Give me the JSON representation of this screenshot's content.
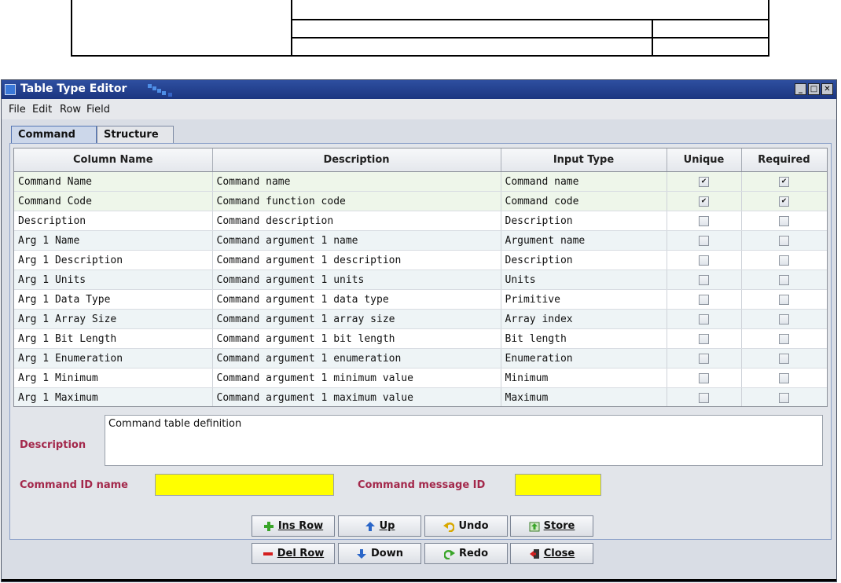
{
  "window": {
    "title": "Table Type Editor"
  },
  "menu": [
    "File",
    "Edit",
    "Row",
    "Field"
  ],
  "tabs": [
    {
      "label": "Command",
      "active": true
    },
    {
      "label": "Structure",
      "active": false
    }
  ],
  "table": {
    "columns": [
      "Column Name",
      "Description",
      "Input Type",
      "Unique",
      "Required"
    ],
    "rows": [
      {
        "name": "Command Name",
        "description": "Command name",
        "input_type": "Command name",
        "unique": true,
        "required": true
      },
      {
        "name": "Command Code",
        "description": "Command function code",
        "input_type": "Command code",
        "unique": true,
        "required": true
      },
      {
        "name": "Description",
        "description": "Command description",
        "input_type": "Description",
        "unique": false,
        "required": false
      },
      {
        "name": "Arg 1 Name",
        "description": "Command argument 1 name",
        "input_type": "Argument name",
        "unique": false,
        "required": false
      },
      {
        "name": "Arg 1 Description",
        "description": "Command argument 1 description",
        "input_type": "Description",
        "unique": false,
        "required": false
      },
      {
        "name": "Arg 1 Units",
        "description": "Command argument 1 units",
        "input_type": "Units",
        "unique": false,
        "required": false
      },
      {
        "name": "Arg 1 Data Type",
        "description": "Command argument 1 data type",
        "input_type": "Primitive",
        "unique": false,
        "required": false
      },
      {
        "name": "Arg 1 Array Size",
        "description": "Command argument 1 array size",
        "input_type": "Array index",
        "unique": false,
        "required": false
      },
      {
        "name": "Arg 1 Bit Length",
        "description": "Command argument 1 bit length",
        "input_type": "Bit length",
        "unique": false,
        "required": false
      },
      {
        "name": "Arg 1 Enumeration",
        "description": "Command argument 1 enumeration",
        "input_type": "Enumeration",
        "unique": false,
        "required": false
      },
      {
        "name": "Arg 1 Minimum",
        "description": "Command argument 1 minimum value",
        "input_type": "Minimum",
        "unique": false,
        "required": false
      },
      {
        "name": "Arg 1 Maximum",
        "description": "Command argument 1 maximum value",
        "input_type": "Maximum",
        "unique": false,
        "required": false
      }
    ]
  },
  "form": {
    "description_label": "Description",
    "description_value": "Command table definition",
    "command_id_name_label": "Command ID name",
    "command_id_name_value": "",
    "command_message_id_label": "Command message ID",
    "command_message_id_value": ""
  },
  "buttons": {
    "ins_row": "Ins Row",
    "del_row": "Del Row",
    "up": "Up",
    "down": "Down",
    "undo": "Undo",
    "redo": "Redo",
    "store": "Store",
    "close": "Close"
  },
  "colors": {
    "label_accent": "#a3284b",
    "required_field_bg": "#ffff00",
    "titlebar": "#1b3580"
  }
}
